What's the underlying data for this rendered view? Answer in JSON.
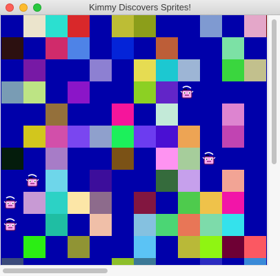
{
  "window": {
    "title": "Kimmy Discovers Sprites!"
  },
  "game": {
    "background": "#0000aa",
    "sprite_name": "pink-bucket-sprite",
    "grid_colors": [
      [
        "#0000aa",
        "#ebe4cc",
        "#2be0d0",
        "#d9282a",
        "#0000aa",
        "#bdbd35",
        "#8c9e1a",
        "#0000aa",
        "#0000aa",
        "#7f9ad1",
        "#0000aa",
        "#e4a7c9",
        "#6e0000"
      ],
      [
        "#2c1010",
        "#0000aa",
        "#d02b6b",
        "#4e83e7",
        "#0000aa",
        "#0424d8",
        "#0000aa",
        "#bd5e38",
        "#0000aa",
        "#0000aa",
        "#7ce1a5",
        "#0000aa",
        "#0000aa"
      ],
      [
        "#0000aa",
        "#7719a5",
        "#0000aa",
        "#0000aa",
        "#8d80d2",
        "#0000aa",
        "#e6dc52",
        "#1cc8d1",
        "#9db5d5",
        "#0000aa",
        "#3ad63e",
        "#c2c08d",
        "#0000aa"
      ],
      [
        "#799cb4",
        "#bde484",
        "#0000aa",
        "#8b15c8",
        "#0000aa",
        "#0000aa",
        "#8cd023",
        "#6225c8",
        "#0000aa",
        "#0000aa",
        "#0000aa",
        "#0000aa",
        "#0000aa"
      ],
      [
        "#0000aa",
        "#0000aa",
        "#94703b",
        "#0000aa",
        "#0000aa",
        "#f5159b",
        "#0000aa",
        "#c3ead8",
        "#0000aa",
        "#0000aa",
        "#dd84d0",
        "#0000aa",
        "#0000aa"
      ],
      [
        "#0000aa",
        "#d2c61d",
        "#d24faa",
        "#7a46f0",
        "#8fa0cc",
        "#1cf05b",
        "#6c3cf0",
        "#4a0fd3",
        "#eda454",
        "#0000aa",
        "#c144b2",
        "#0000aa",
        "#0000aa"
      ],
      [
        "#041c0c",
        "#0000aa",
        "#a77cc7",
        "#0000aa",
        "#0000aa",
        "#7b5216",
        "#0000aa",
        "#fe93f1",
        "#a6cd9b",
        "#0000aa",
        "#0000aa",
        "#0000aa",
        "#0000aa"
      ],
      [
        "#0000aa",
        "#0000aa",
        "#6ed6ea",
        "#0000aa",
        "#3d0e9b",
        "#0000aa",
        "#0000aa",
        "#356b3c",
        "#c6a0ec",
        "#0000aa",
        "#f2a495",
        "#0000aa",
        "#0000aa"
      ],
      [
        "#0000aa",
        "#c89ad4",
        "#2cd2c5",
        "#fce6a7",
        "#8d6b8c",
        "#0000aa",
        "#821640",
        "#0000aa",
        "#4ecb4d",
        "#efc24a",
        "#f215a8",
        "#0000aa",
        "#0000aa"
      ],
      [
        "#0000aa",
        "#0000aa",
        "#1fbea3",
        "#0000aa",
        "#f0bfa8",
        "#0000aa",
        "#85c1e0",
        "#4bd674",
        "#e87657",
        "#7ddbaa",
        "#34e2ec",
        "#0000aa",
        "#0000aa"
      ],
      [
        "#0000aa",
        "#2bee14",
        "#0000aa",
        "#909434",
        "#0000aa",
        "#0000aa",
        "#5bc3f5",
        "#0000aa",
        "#b9b938",
        "#8ff512",
        "#6e0034",
        "#fb5862",
        "#0000aa"
      ],
      [
        "#3a4a7a",
        "#0000aa",
        "#0000aa",
        "#0000aa",
        "#0000aa",
        "#8dbf2a",
        "#3b7896",
        "#0000aa",
        "#0000aa",
        "#2c2cc0",
        "#0000aa",
        "#3a8ad8",
        "#0000aa"
      ]
    ],
    "sprites": [
      {
        "col": 8,
        "row": 3
      },
      {
        "col": 9,
        "row": 6
      },
      {
        "col": 1,
        "row": 7
      },
      {
        "col": 0,
        "row": 8
      },
      {
        "col": 0,
        "row": 9
      }
    ]
  }
}
